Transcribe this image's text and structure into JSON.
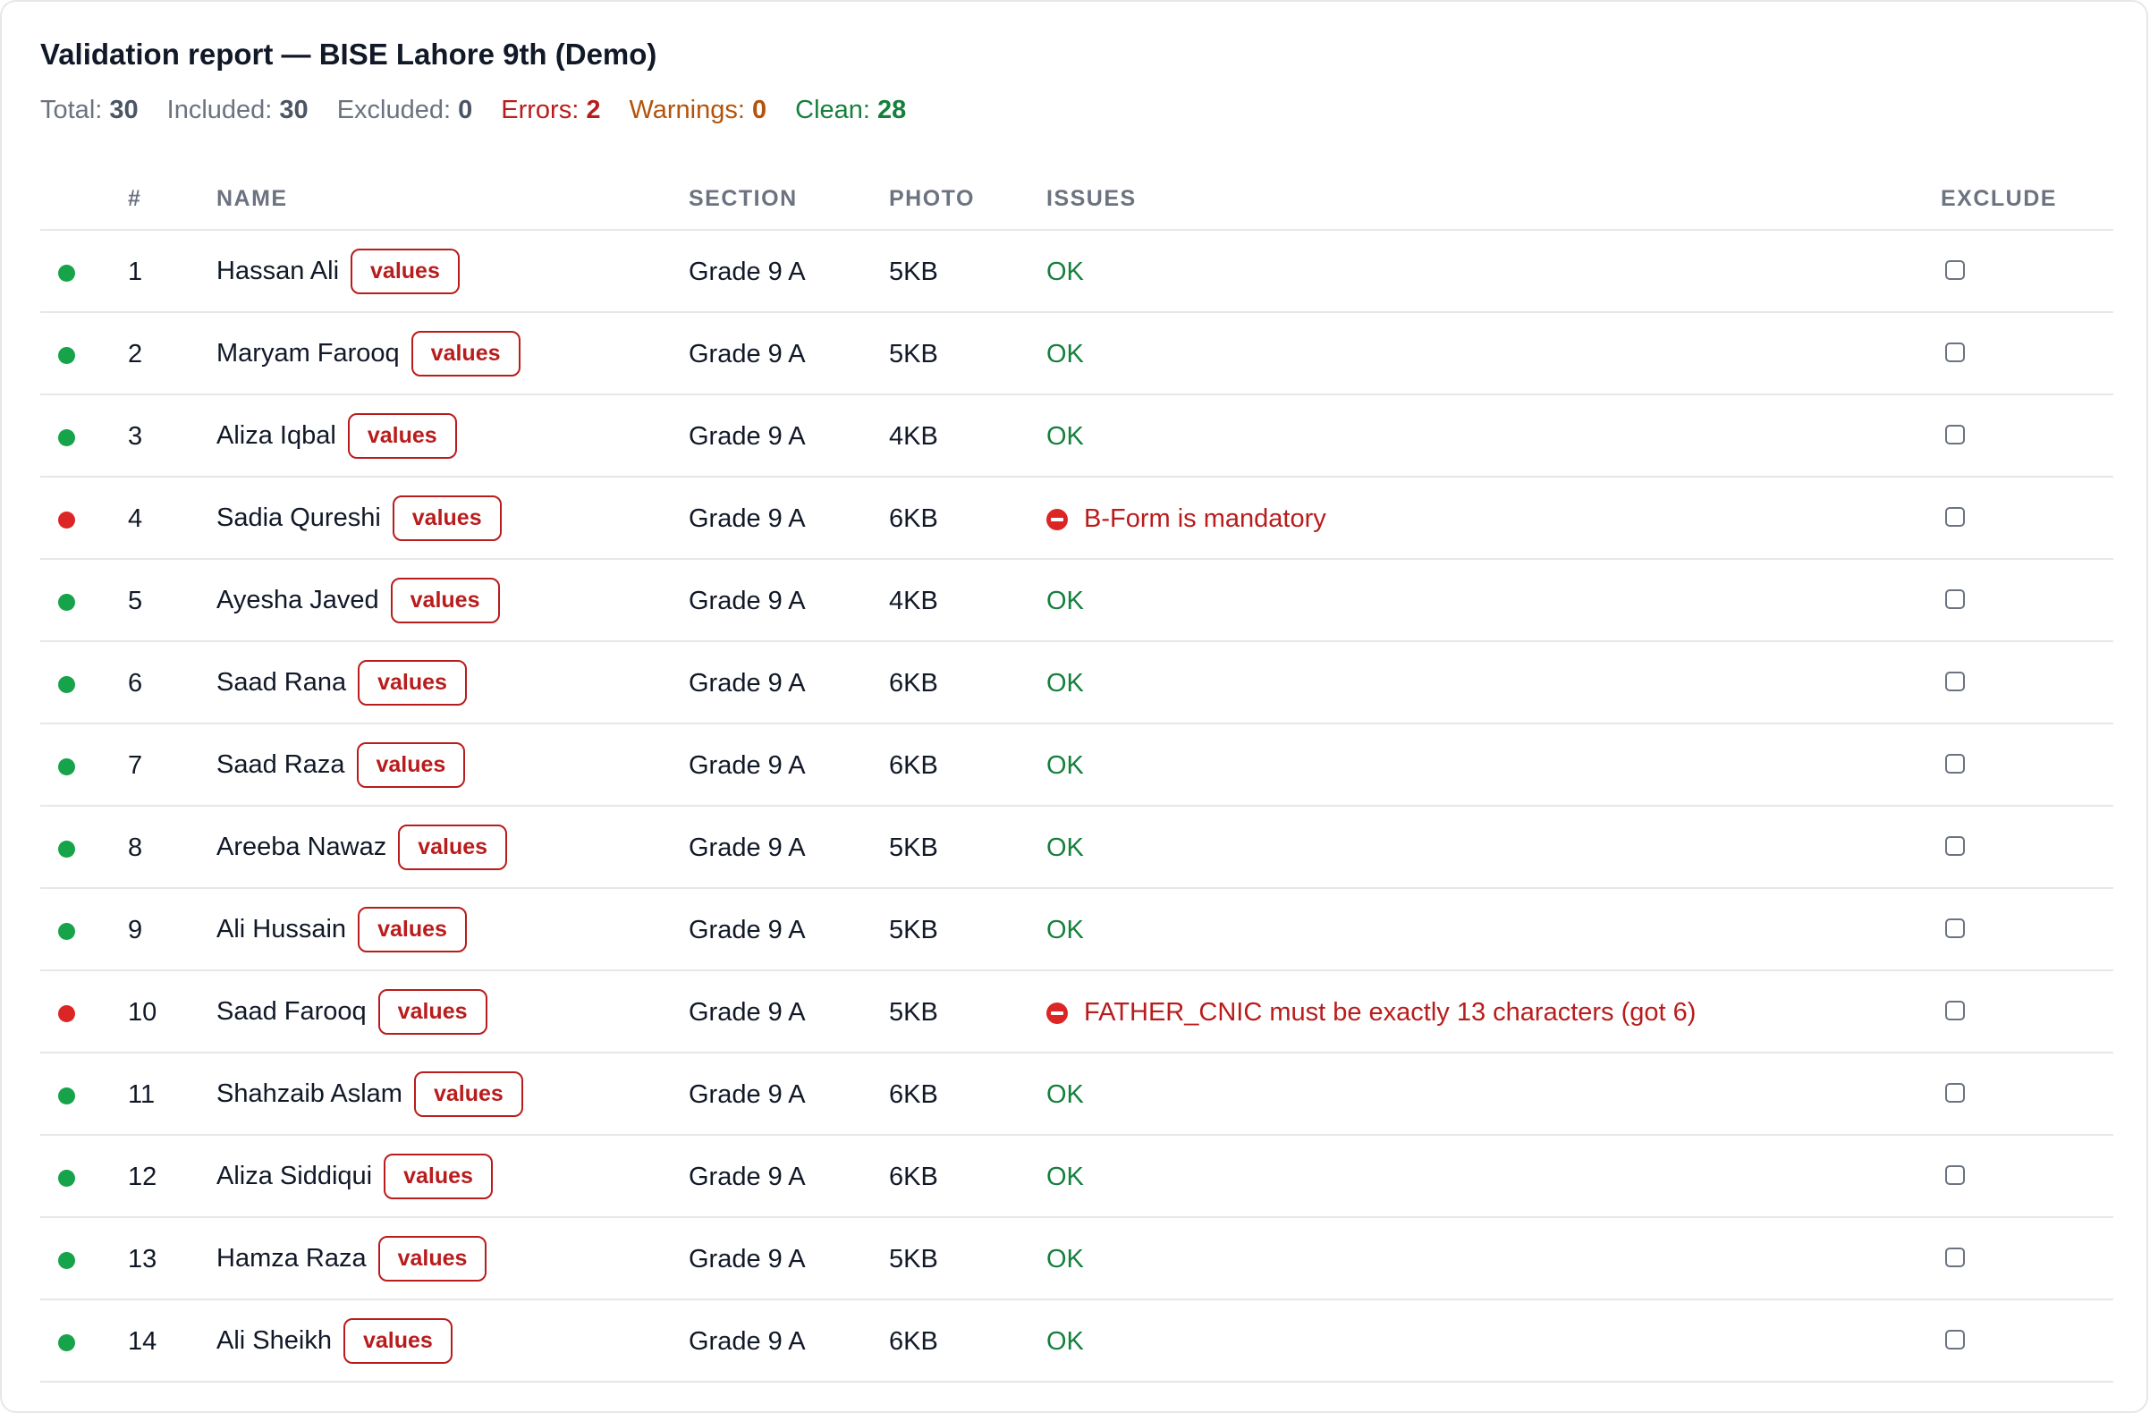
{
  "report": {
    "title": "Validation report — BISE Lahore 9th (Demo)",
    "summary": [
      {
        "label": "Total:",
        "value": "30",
        "tone": "neutral"
      },
      {
        "label": "Included:",
        "value": "30",
        "tone": "neutral"
      },
      {
        "label": "Excluded:",
        "value": "0",
        "tone": "neutral"
      },
      {
        "label": "Errors:",
        "value": "2",
        "tone": "error"
      },
      {
        "label": "Warnings:",
        "value": "0",
        "tone": "warning"
      },
      {
        "label": "Clean:",
        "value": "28",
        "tone": "clean"
      }
    ]
  },
  "table": {
    "headers": {
      "num": "#",
      "name": "NAME",
      "section": "SECTION",
      "photo": "PHOTO",
      "issues": "ISSUES",
      "exclude": "EXCLUDE"
    },
    "values_label": "values",
    "rows": [
      {
        "num": "1",
        "name": "Hassan Ali",
        "section": "Grade 9 A",
        "photo": "5KB",
        "status": "ok",
        "issue": "OK"
      },
      {
        "num": "2",
        "name": "Maryam Farooq",
        "section": "Grade 9 A",
        "photo": "5KB",
        "status": "ok",
        "issue": "OK"
      },
      {
        "num": "3",
        "name": "Aliza Iqbal",
        "section": "Grade 9 A",
        "photo": "4KB",
        "status": "ok",
        "issue": "OK"
      },
      {
        "num": "4",
        "name": "Sadia Qureshi",
        "section": "Grade 9 A",
        "photo": "6KB",
        "status": "error",
        "issue": "B-Form is mandatory"
      },
      {
        "num": "5",
        "name": "Ayesha Javed",
        "section": "Grade 9 A",
        "photo": "4KB",
        "status": "ok",
        "issue": "OK"
      },
      {
        "num": "6",
        "name": "Saad Rana",
        "section": "Grade 9 A",
        "photo": "6KB",
        "status": "ok",
        "issue": "OK"
      },
      {
        "num": "7",
        "name": "Saad Raza",
        "section": "Grade 9 A",
        "photo": "6KB",
        "status": "ok",
        "issue": "OK"
      },
      {
        "num": "8",
        "name": "Areeba Nawaz",
        "section": "Grade 9 A",
        "photo": "5KB",
        "status": "ok",
        "issue": "OK"
      },
      {
        "num": "9",
        "name": "Ali Hussain",
        "section": "Grade 9 A",
        "photo": "5KB",
        "status": "ok",
        "issue": "OK"
      },
      {
        "num": "10",
        "name": "Saad Farooq",
        "section": "Grade 9 A",
        "photo": "5KB",
        "status": "error",
        "issue": "FATHER_CNIC must be exactly 13 characters (got 6)"
      },
      {
        "num": "11",
        "name": "Shahzaib Aslam",
        "section": "Grade 9 A",
        "photo": "6KB",
        "status": "ok",
        "issue": "OK"
      },
      {
        "num": "12",
        "name": "Aliza Siddiqui",
        "section": "Grade 9 A",
        "photo": "6KB",
        "status": "ok",
        "issue": "OK"
      },
      {
        "num": "13",
        "name": "Hamza Raza",
        "section": "Grade 9 A",
        "photo": "5KB",
        "status": "ok",
        "issue": "OK"
      },
      {
        "num": "14",
        "name": "Ali Sheikh",
        "section": "Grade 9 A",
        "photo": "6KB",
        "status": "ok",
        "issue": "OK"
      }
    ]
  },
  "colors": {
    "ok": "#16a34a",
    "error": "#dc2626",
    "border": "#e5e7eb"
  },
  "icons": {
    "status_ok": "green-dot-icon",
    "status_error": "red-dot-icon",
    "issue_error": "no-entry-icon"
  }
}
